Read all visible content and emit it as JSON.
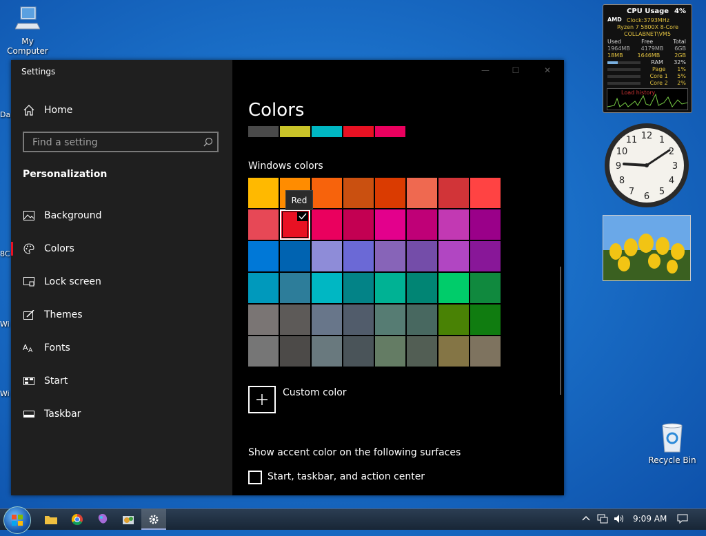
{
  "desktop": {
    "icons": [
      {
        "label": "My Computer"
      },
      {
        "label": "Recycle Bin"
      }
    ],
    "edge_fragments": [
      "Da",
      "8C",
      "Wi",
      "Wi"
    ]
  },
  "settings": {
    "window_title": "Settings",
    "home_label": "Home",
    "search_placeholder": "Find a setting",
    "section_title": "Personalization",
    "nav_items": [
      {
        "label": "Background",
        "icon": "picture-icon"
      },
      {
        "label": "Colors",
        "icon": "palette-icon"
      },
      {
        "label": "Lock screen",
        "icon": "lock-screen-icon"
      },
      {
        "label": "Themes",
        "icon": "brush-icon"
      },
      {
        "label": "Fonts",
        "icon": "font-icon"
      },
      {
        "label": "Start",
        "icon": "start-icon"
      },
      {
        "label": "Taskbar",
        "icon": "taskbar-icon"
      }
    ],
    "active_item": "Colors",
    "page_title": "Colors",
    "recent_colors": [
      "#4a4a4a",
      "#c9c329",
      "#00b7c3",
      "#e81123",
      "#ea005e"
    ],
    "windows_colors_label": "Windows colors",
    "selected_color": "Red",
    "tooltip": "Red",
    "palette": [
      [
        "#ffb900",
        "#ff8c00",
        "#f7630c",
        "#ca5010",
        "#da3b01",
        "#ef6950",
        "#d13438",
        "#ff4343"
      ],
      [
        "#e74856",
        "#e81123",
        "#ea005e",
        "#c30052",
        "#e3008c",
        "#bf0077",
        "#c239b3",
        "#9a0089"
      ],
      [
        "#0078d7",
        "#0063b1",
        "#8e8cd8",
        "#6b69d6",
        "#8764b8",
        "#744da9",
        "#b146c2",
        "#881798"
      ],
      [
        "#0099bc",
        "#2d7d9a",
        "#00b7c3",
        "#038387",
        "#00b294",
        "#018574",
        "#00cc6a",
        "#10893e"
      ],
      [
        "#7a7574",
        "#5d5a58",
        "#68768a",
        "#515c6b",
        "#567c73",
        "#486860",
        "#498205",
        "#107c10"
      ],
      [
        "#767676",
        "#4c4a48",
        "#69797e",
        "#4a5459",
        "#647c64",
        "#525e54",
        "#847545",
        "#7e735f"
      ]
    ],
    "custom_color_label": "Custom color",
    "surfaces_label": "Show accent color on the following surfaces",
    "checkbox_label": "Start, taskbar, and action center",
    "accent": "#e81123"
  },
  "cpu_gadget": {
    "title": "CPU Usage",
    "percent": "4%",
    "brand": "AMD",
    "clock": "Clock:3793MHz",
    "cpu_name": "Ryzen 7 5800X 8-Core",
    "host": "COLLABNET\\VM5",
    "headers": [
      "Used",
      "Free",
      "Total"
    ],
    "row1": [
      "1964MB",
      "4179MB",
      "6GB"
    ],
    "row2": [
      "18MB",
      "1646MB",
      "2GB"
    ],
    "meters": [
      {
        "label": "RAM",
        "value": "32%"
      },
      {
        "label": "Page",
        "value": "1%"
      },
      {
        "label": "Core 1",
        "value": "5%"
      },
      {
        "label": "Core 2",
        "value": "2%"
      }
    ],
    "graph_label": "Load history"
  },
  "taskbar": {
    "time": "9:09 AM",
    "apps": [
      "file-explorer-icon",
      "chrome-icon",
      "paint-icon",
      "control-panel-icon",
      "settings-gear-icon"
    ]
  }
}
